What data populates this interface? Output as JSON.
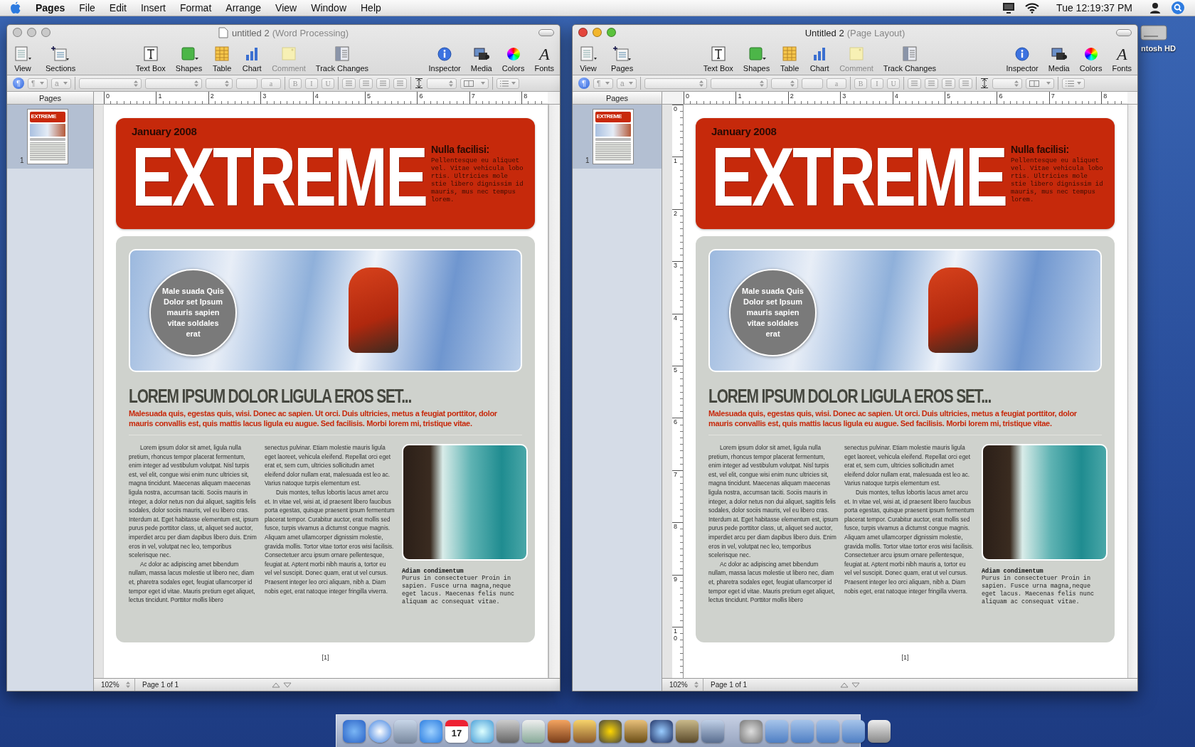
{
  "menu_bar": {
    "app": "Pages",
    "menus": [
      "File",
      "Edit",
      "Insert",
      "Format",
      "Arrange",
      "View",
      "Window",
      "Help"
    ],
    "clock": "Tue 12:19:37 PM"
  },
  "desktop_icon": {
    "label": "ntosh HD"
  },
  "windows": [
    {
      "title": "untitled 2",
      "mode": "(Word Processing)",
      "active": false,
      "toolbar": {
        "left": [
          {
            "kind": "view",
            "label": "View",
            "disabled": false
          },
          {
            "kind": "sections",
            "label": "Sections",
            "disabled": false
          }
        ],
        "center": [
          {
            "kind": "textbox",
            "label": "Text Box",
            "disabled": false
          },
          {
            "kind": "shapes",
            "label": "Shapes",
            "disabled": false
          },
          {
            "kind": "table",
            "label": "Table",
            "disabled": false
          },
          {
            "kind": "chart",
            "label": "Chart",
            "disabled": false
          },
          {
            "kind": "comment",
            "label": "Comment",
            "disabled": true
          },
          {
            "kind": "track",
            "label": "Track Changes",
            "disabled": false
          }
        ],
        "right": [
          {
            "kind": "inspector",
            "label": "Inspector",
            "disabled": false
          },
          {
            "kind": "media",
            "label": "Media",
            "disabled": false
          },
          {
            "kind": "colors",
            "label": "Colors",
            "disabled": false
          },
          {
            "kind": "fonts",
            "label": "Fonts",
            "glyph": "A",
            "disabled": false
          }
        ]
      },
      "format_bar": [
        {
          "kind": "paragraph",
          "glyph": "¶"
        },
        {
          "kind": "popup",
          "label": "¶"
        },
        {
          "kind": "popup",
          "label": "a"
        },
        {
          "kind": "sep"
        },
        {
          "kind": "menu"
        },
        {
          "kind": "menu"
        },
        {
          "kind": "menu"
        },
        {
          "kind": "field"
        },
        {
          "kind": "field",
          "label": "a"
        },
        {
          "kind": "sep"
        },
        {
          "kind": "style",
          "label": "B"
        },
        {
          "kind": "style",
          "label": "I"
        },
        {
          "kind": "style",
          "label": "U"
        },
        {
          "kind": "sep"
        },
        {
          "kind": "align"
        },
        {
          "kind": "align"
        },
        {
          "kind": "align"
        },
        {
          "kind": "align"
        },
        {
          "kind": "sep"
        },
        {
          "kind": "spacing"
        },
        {
          "kind": "menu"
        },
        {
          "kind": "columns"
        },
        {
          "kind": "sep"
        },
        {
          "kind": "list"
        }
      ],
      "sidebar": {
        "header": "Pages",
        "pages": [
          {
            "number": "1",
            "thumb_title": "EXTREME",
            "selected": true
          }
        ]
      },
      "ruler": [
        "0",
        "1",
        "2",
        "3",
        "4",
        "5",
        "6",
        "7",
        "8"
      ],
      "document": {
        "date": "January 2008",
        "masthead": "EXTREME",
        "aside_title": "Nulla facilisi:",
        "aside_text": "Pellentesque eu aliquet vel. Vitae vehicula lobo rtis. Ultricies mole stie libero dignissim id mauris, mus nec tempus lorem.",
        "callout": "Male suada Quis Dolor set Ipsum mauris sapien vitae soldales erat",
        "headline": "LOREM IPSUM DOLOR LIGULA EROS SET...",
        "deck": "Malesuada quis, egestas quis, wisi. Donec ac sapien. Ut orci. Duis ultricies, metus a feugiat porttitor, dolor mauris convallis est, quis mattis lacus ligula eu augue. Sed facilisis. Morbi lorem mi, tristique vitae.",
        "columns": [
          [
            "Lorem ipsum dolor sit amet, ligula nulla pretium, rhoncus tempor placerat fermentum, enim integer ad vestibulum volutpat. Nisl turpis est, vel elit, congue wisi enim nunc ultricies sit, magna tincidunt. Maecenas aliquam maecenas ligula nostra, accumsan taciti. Sociis mauris in integer, a dolor netus non dui aliquet, sagittis felis sodales, dolor sociis mauris, vel eu libero cras. Interdum at. Eget habitasse elementum est, ipsum purus pede porttitor class, ut, aliquet sed auctor, imperdiet arcu per diam dapibus libero duis. Enim eros in vel, volutpat nec leo, temporibus scelerisque nec.",
            "Ac dolor ac adipiscing amet bibendum nullam, massa lacus molestie ut libero nec, diam et, pharetra sodales eget, feugiat ullamcorper id tempor eget id vitae. Mauris pretium eget aliquet, lectus tincidunt. Porttitor mollis libero"
          ],
          [
            "senectus pulvinar. Etiam molestie mauris ligula eget laoreet, vehicula eleifend. Repellat orci eget erat et, sem cum, ultricies sollicitudin amet eleifend dolor nullam erat, malesuada est leo ac. Varius natoque turpis elementum est.",
            "Duis montes, tellus lobortis lacus amet arcu et. In vitae vel, wisi at, id praesent libero faucibus porta egestas, quisque praesent ipsum fermentum placerat tempor. Curabitur auctor, erat mollis sed fusce, turpis vivamus a dictumst congue magnis. Aliquam amet ullamcorper dignissim molestie, gravida mollis. Tortor vitae tortor eros wisi facilisis. Consectetuer arcu ipsum ornare pellentesque, feugiat at. Aptent morbi nibh mauris a, tortor eu vel vel suscipit. Donec quam, erat ut vel cursus. Praesent integer leo orci aliquam, nibh a. Diam nobis eget, erat natoque integer fringilla viverra."
          ]
        ],
        "caption_title": "Adiam condimentum",
        "caption_text": "Purus in consectetuer Proin in sapien. Fusce urna magna,neque eget lacus. Maecenas felis nunc aliquam ac consequat vitae.",
        "page_number": "[1]"
      },
      "status": {
        "zoom": "102%",
        "page": "Page 1 of 1"
      }
    },
    {
      "title": "Untitled 2",
      "mode": "(Page Layout)",
      "active": true,
      "toolbar": {
        "left": [
          {
            "kind": "view",
            "label": "View",
            "disabled": false
          },
          {
            "kind": "sections",
            "label": "Pages",
            "disabled": false
          }
        ],
        "center": [
          {
            "kind": "textbox",
            "label": "Text Box",
            "disabled": false
          },
          {
            "kind": "shapes",
            "label": "Shapes",
            "disabled": false
          },
          {
            "kind": "table",
            "label": "Table",
            "disabled": false
          },
          {
            "kind": "chart",
            "label": "Chart",
            "disabled": false
          },
          {
            "kind": "comment",
            "label": "Comment",
            "disabled": true
          },
          {
            "kind": "track",
            "label": "Track Changes",
            "disabled": false
          }
        ],
        "right": [
          {
            "kind": "inspector",
            "label": "Inspector",
            "disabled": false
          },
          {
            "kind": "media",
            "label": "Media",
            "disabled": false
          },
          {
            "kind": "colors",
            "label": "Colors",
            "disabled": false
          },
          {
            "kind": "fonts",
            "label": "Fonts",
            "glyph": "A",
            "disabled": false
          }
        ]
      },
      "format_bar": [
        {
          "kind": "paragraph",
          "glyph": "¶"
        },
        {
          "kind": "popup",
          "label": "¶"
        },
        {
          "kind": "popup",
          "label": "a"
        },
        {
          "kind": "sep"
        },
        {
          "kind": "menu"
        },
        {
          "kind": "menu"
        },
        {
          "kind": "menu"
        },
        {
          "kind": "field"
        },
        {
          "kind": "field",
          "label": "a"
        },
        {
          "kind": "sep"
        },
        {
          "kind": "style",
          "label": "B"
        },
        {
          "kind": "style",
          "label": "I"
        },
        {
          "kind": "style",
          "label": "U"
        },
        {
          "kind": "sep"
        },
        {
          "kind": "align"
        },
        {
          "kind": "align"
        },
        {
          "kind": "align"
        },
        {
          "kind": "align"
        },
        {
          "kind": "sep"
        },
        {
          "kind": "spacing"
        },
        {
          "kind": "menu"
        },
        {
          "kind": "columns"
        },
        {
          "kind": "sep"
        },
        {
          "kind": "list"
        }
      ],
      "sidebar": {
        "header": "Pages",
        "pages": [
          {
            "number": "1",
            "thumb_title": "EXTREME",
            "selected": true
          }
        ]
      },
      "ruler": [
        "0",
        "1",
        "2",
        "3",
        "4",
        "5",
        "6",
        "7",
        "8"
      ],
      "vertical_ruler": [
        "0",
        "1",
        "2",
        "3",
        "4",
        "5",
        "6",
        "7",
        "8",
        "9",
        "10"
      ],
      "document": {
        "date": "January 2008",
        "masthead": "EXTREME",
        "aside_title": "Nulla facilisi:",
        "aside_text": "Pellentesque eu aliquet vel. Vitae vehicula lobo rtis. Ultricies mole stie libero dignissim id mauris, mus nec tempus lorem.",
        "callout": "Male suada Quis Dolor set Ipsum mauris sapien vitae soldales erat",
        "headline": "LOREM IPSUM DOLOR LIGULA EROS SET...",
        "deck": "Malesuada quis, egestas quis, wisi. Donec ac sapien. Ut orci. Duis ultricies, metus a feugiat porttitor, dolor mauris convallis est, quis mattis lacus ligula eu augue. Sed facilisis. Morbi lorem mi, tristique vitae.",
        "columns": [
          [
            "Lorem ipsum dolor sit amet, ligula nulla pretium, rhoncus tempor placerat fermentum, enim integer ad vestibulum volutpat. Nisl turpis est, vel elit, congue wisi enim nunc ultricies sit, magna tincidunt. Maecenas aliquam maecenas ligula nostra, accumsan taciti. Sociis mauris in integer, a dolor netus non dui aliquet, sagittis felis sodales, dolor sociis mauris, vel eu libero cras. Interdum at. Eget habitasse elementum est, ipsum purus pede porttitor class, ut, aliquet sed auctor, imperdiet arcu per diam dapibus libero duis. Enim eros in vel, volutpat nec leo, temporibus scelerisque nec.",
            "Ac dolor ac adipiscing amet bibendum nullam, massa lacus molestie ut libero nec, diam et, pharetra sodales eget, feugiat ullamcorper id tempor eget id vitae. Mauris pretium eget aliquet, lectus tincidunt. Porttitor mollis libero"
          ],
          [
            "senectus pulvinar. Etiam molestie mauris ligula eget laoreet, vehicula eleifend. Repellat orci eget erat et, sem cum, ultricies sollicitudin amet eleifend dolor nullam erat, malesuada est leo ac. Varius natoque turpis elementum est.",
            "Duis montes, tellus lobortis lacus amet arcu et. In vitae vel, wisi at, id praesent libero faucibus porta egestas, quisque praesent ipsum fermentum placerat tempor. Curabitur auctor, erat mollis sed fusce, turpis vivamus a dictumst congue magnis. Aliquam amet ullamcorper dignissim molestie, gravida mollis. Tortor vitae tortor eros wisi facilisis. Consectetuer arcu ipsum ornare pellentesque, feugiat at. Aptent morbi nibh mauris a, tortor eu vel vel suscipit. Donec quam, erat ut vel cursus. Praesent integer leo orci aliquam, nibh a. Diam nobis eget, erat natoque integer fringilla viverra."
          ]
        ],
        "caption_title": "Adiam condimentum",
        "caption_text": "Purus in consectetuer Proin in sapien. Fusce urna magna,neque eget lacus. Maecenas felis nunc aliquam ac consequat vitae.",
        "page_number": "[1]"
      },
      "status": {
        "zoom": "102%",
        "page": "Page 1 of 1"
      }
    }
  ],
  "dock": {
    "calendar_day": "17"
  }
}
